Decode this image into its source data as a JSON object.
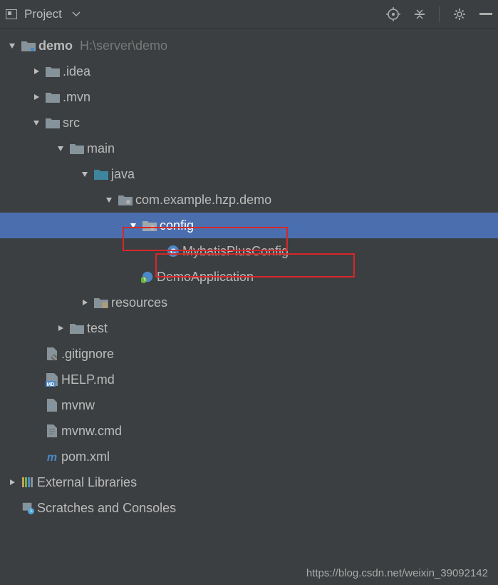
{
  "toolbar": {
    "project_label": "Project"
  },
  "tree": {
    "demo": {
      "name": "demo",
      "path": "H:\\server\\demo"
    },
    "idea": ".idea",
    "mvn": ".mvn",
    "src": "src",
    "main": "main",
    "java": "java",
    "package": "com.example.hzp.demo",
    "config": "config",
    "mybatis": "MybatisPlusConfig",
    "demoapp": "DemoApplication",
    "resources": "resources",
    "test": "test",
    "gitignore": ".gitignore",
    "helpmd": "HELP.md",
    "mvnw": "mvnw",
    "mvnwcmd": "mvnw.cmd",
    "pomxml": "pom.xml",
    "extlib": "External Libraries",
    "scratches": "Scratches and Consoles"
  },
  "watermark": "https://blog.csdn.net/weixin_39092142"
}
